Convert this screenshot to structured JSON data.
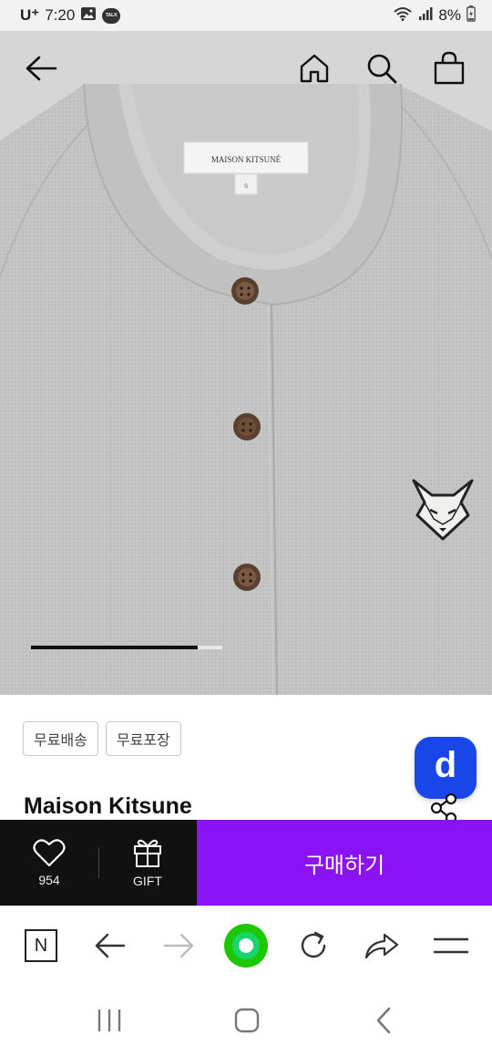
{
  "status": {
    "carrier": "U⁺",
    "time": "7:20",
    "talk_badge": "TALK",
    "battery": "8%"
  },
  "header": {
    "icons": [
      "back-arrow-icon",
      "home-icon",
      "search-icon",
      "shopping-bag-icon"
    ]
  },
  "product_image": {
    "label_brand": "MAISON KITSUNÉ",
    "label_size": "S",
    "image_index_progress": 0.87
  },
  "tags": [
    "무료배송",
    "무료포장"
  ],
  "product": {
    "brand": "Maison Kitsune"
  },
  "floating": {
    "d_label": "d"
  },
  "action_bar": {
    "like_count": "954",
    "gift_label": "GIFT",
    "buy_label": "구매하기"
  },
  "browser_bar": {
    "n_label": "N",
    "icons": [
      "naver-n-icon",
      "back-icon",
      "forward-icon",
      "green-dot-icon",
      "reload-icon",
      "share-icon",
      "menu-icon"
    ]
  },
  "system_nav": {
    "icons": [
      "recents-icon",
      "home-icon",
      "back-icon"
    ]
  },
  "colors": {
    "accent": "#8a12f5",
    "d_button": "#1846e8",
    "green": "#1ec800"
  }
}
